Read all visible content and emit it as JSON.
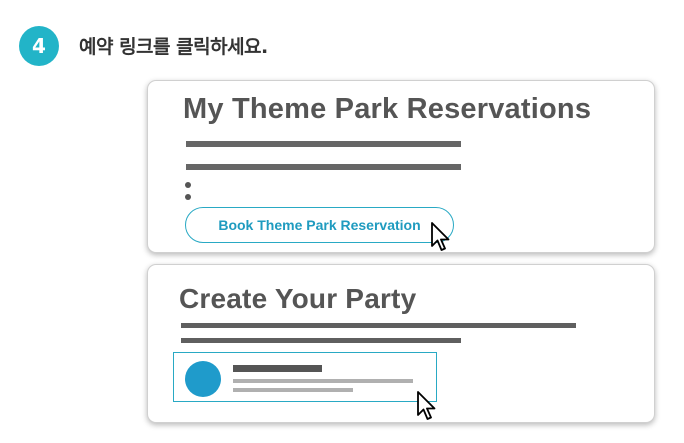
{
  "step": {
    "number": "4",
    "instruction": "예약 링크를 클릭하세요."
  },
  "reservations_card": {
    "title": "My Theme Park Reservations",
    "book_button_label": "Book Theme Park Reservation"
  },
  "party_card": {
    "title": "Create Your Party"
  },
  "colors": {
    "accent": "#22b4c8",
    "link": "#1f9bbf",
    "avatar": "#1f9bcb",
    "placeholder_bar": "#666666"
  },
  "icons": [
    "mouse-pointer-icon"
  ]
}
